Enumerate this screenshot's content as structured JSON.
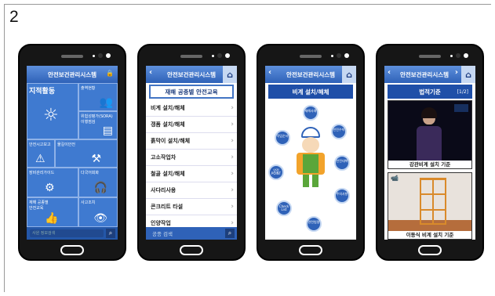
{
  "figure_number": "2",
  "phone1": {
    "title": "안전보건관리시스템",
    "tiles": {
      "t1": "지적활동",
      "t2": "출역현황",
      "t3": "위험성평가(SORA)\n이행점검",
      "t4": "안전시고보고",
      "t5": "물길이안전",
      "t6": "장비관리가이드",
      "t7": "다국어회화",
      "t8": "재해 공종별\n안전교육",
      "t9": "사고조치"
    },
    "search_placeholder": "사원 정보검색"
  },
  "phone2": {
    "title": "안전보건관리시스템",
    "list_title": "재해 공종별 안전교육",
    "items": [
      "비계 설치/해체",
      "갱폼 설치/해체",
      "흙막이 설치/해체",
      "고소작업차",
      "철골 설치/해체",
      "사다리사용",
      "콘크리트 타설",
      "인양작업"
    ],
    "search_label": "공종 검색"
  },
  "phone3": {
    "title": "안전보건관리시스템",
    "list_title": "비계 설치/해체",
    "bubbles": {
      "b1": "재해사례",
      "b2": "작업순서",
      "b3": "안전수칙",
      "b4": "안전대책",
      "b5": "안전\nPOINT",
      "b6": "Check List",
      "b7": "주의사항",
      "b8": "관련법령"
    }
  },
  "phone4": {
    "title": "안전보건관리시스템",
    "list_title": "법적기준",
    "page": "[1/2]",
    "caption1": "강관비계 설치 기준",
    "caption2": "이동식 비계 설치 기준"
  }
}
